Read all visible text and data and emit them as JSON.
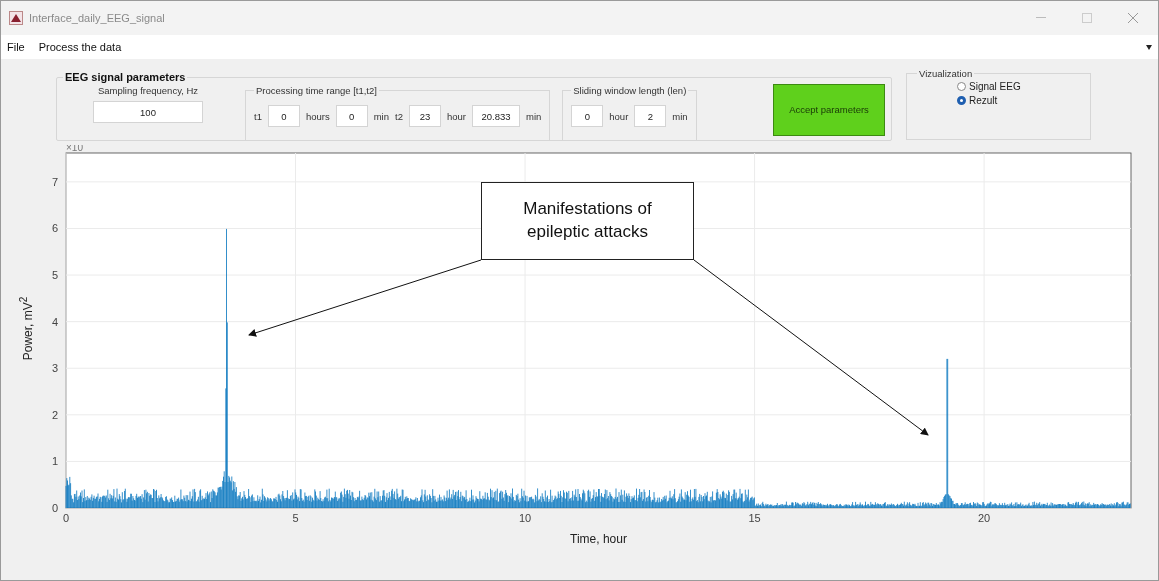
{
  "window": {
    "title": "Interface_daily_EEG_signal"
  },
  "menu": [
    {
      "label": "File"
    },
    {
      "label": "Process the data"
    }
  ],
  "parameters": {
    "title": "EEG signal parameters",
    "sampling": {
      "label": "Sampling frequency, Hz",
      "value": "100"
    },
    "time_range": {
      "title": "Processing time range [t1,t2]",
      "items": [
        {
          "kind": "label",
          "text": "t1"
        },
        {
          "kind": "field",
          "value": "0"
        },
        {
          "kind": "label",
          "text": "hours"
        },
        {
          "kind": "field",
          "value": "0"
        },
        {
          "kind": "label",
          "text": "min"
        },
        {
          "kind": "label",
          "text": "t2"
        },
        {
          "kind": "field",
          "value": "23"
        },
        {
          "kind": "label",
          "text": "hour"
        },
        {
          "kind": "field",
          "value": "20.833"
        },
        {
          "kind": "label",
          "text": "min"
        }
      ]
    },
    "window_length": {
      "title": "Sliding window length (len)",
      "items": [
        {
          "kind": "field",
          "value": "0"
        },
        {
          "kind": "label",
          "text": "hour"
        },
        {
          "kind": "field",
          "value": "2"
        },
        {
          "kind": "label",
          "text": "min"
        }
      ]
    },
    "accept_button": "Accept parameters"
  },
  "visualization": {
    "title": "Vizualization",
    "options": [
      {
        "label": "Signal EEG",
        "selected": false
      },
      {
        "label": "Rezult",
        "selected": true
      }
    ]
  },
  "plot": {
    "exponent": "×10",
    "ylabel": "Power, mV$^{2}$",
    "xlabel": "Time, hour",
    "xticks": [
      "0",
      "5",
      "10",
      "15",
      "20"
    ],
    "yticks": [
      "7",
      "6",
      "5",
      "4",
      "3",
      "2",
      "1",
      "0"
    ],
    "annotation": "Manifestations of epileptic attacks"
  }
}
